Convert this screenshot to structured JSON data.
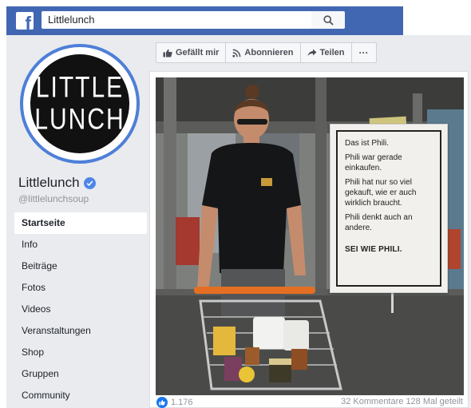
{
  "header": {
    "logo_letter": "f",
    "search_value": "Littlelunch",
    "search_icon": "search-icon"
  },
  "profile": {
    "logo_line1": "LITTLE",
    "logo_line2": "LUNCH",
    "name": "Littlelunch",
    "handle": "@littlelunchsoup",
    "verified_icon": "verified-check-icon"
  },
  "nav": {
    "items": [
      {
        "label": "Startseite",
        "active": true
      },
      {
        "label": "Info"
      },
      {
        "label": "Beiträge"
      },
      {
        "label": "Fotos"
      },
      {
        "label": "Videos"
      },
      {
        "label": "Veranstaltungen"
      },
      {
        "label": "Shop"
      },
      {
        "label": "Gruppen"
      },
      {
        "label": "Community"
      }
    ]
  },
  "actions": {
    "like": "Gefällt mir",
    "follow": "Abonnieren",
    "share": "Teilen",
    "more": "···"
  },
  "sign": {
    "line1": "Das ist Phili.",
    "line2": "Phili war gerade einkaufen.",
    "line3": "Phili hat nur so viel gekauft, wie er auch wirklich braucht.",
    "line4": "Phili denkt auch an andere.",
    "line5": "SEI WIE PHILI."
  },
  "post_footer": {
    "reactions": "1.176",
    "comments_shares": "32 Kommentare  128 Mal geteilt"
  },
  "colors": {
    "facebook_blue": "#4267b2",
    "sidebar_bg": "#e9ebee",
    "profile_ring": "#4e7fd8"
  }
}
